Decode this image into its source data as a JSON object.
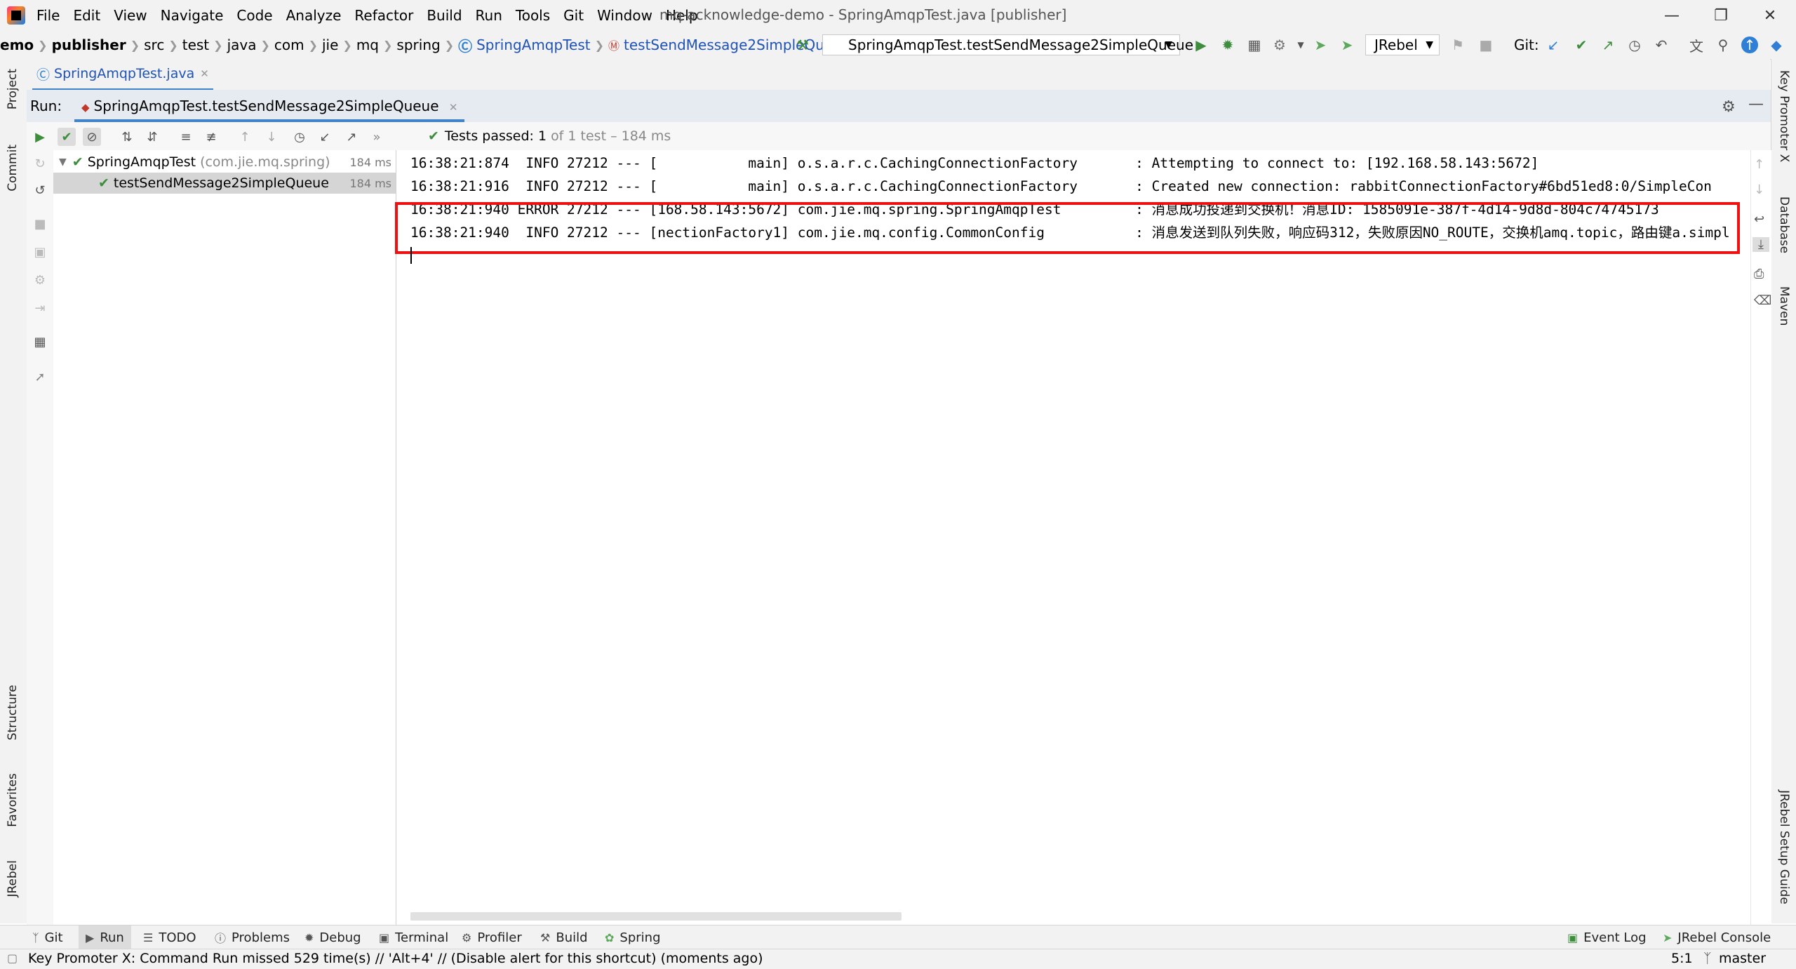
{
  "window": {
    "title": "mq-acknowledge-demo - SpringAmqpTest.java [publisher]",
    "menu": [
      "File",
      "Edit",
      "View",
      "Navigate",
      "Code",
      "Analyze",
      "Refactor",
      "Build",
      "Run",
      "Tools",
      "Git",
      "Window",
      "Help"
    ]
  },
  "breadcrumb": [
    "emo",
    "publisher",
    "src",
    "test",
    "java",
    "com",
    "jie",
    "mq",
    "spring",
    "SpringAmqpTest",
    "testSendMessage2SimpleQueue"
  ],
  "toolbar": {
    "run_config": "SpringAmqpTest.testSendMessage2SimpleQueue",
    "jrebel": "JRebel",
    "git_label": "Git:"
  },
  "editor_tab": "SpringAmqpTest.java",
  "left_strip": [
    "Project",
    "Commit",
    "Structure",
    "Favorites",
    "JRebel"
  ],
  "right_strip": [
    "Key Promoter X",
    "Database",
    "Maven",
    "JRebel Setup Guide"
  ],
  "run_panel": {
    "label": "Run:",
    "tab": "SpringAmqpTest.testSendMessage2SimpleQueue",
    "status_passed": "Tests passed: 1",
    "status_rest": "of 1 test – 184 ms"
  },
  "test_tree": {
    "root_name": "SpringAmqpTest",
    "root_pkg": "(com.jie.mq.spring)",
    "root_time": "184 ms",
    "child_name": "testSendMessage2SimpleQueue",
    "child_time": "184 ms"
  },
  "console": [
    "16:38:21:874  INFO 27212 --- [           main] o.s.a.r.c.CachingConnectionFactory       : Attempting to connect to: [192.168.58.143:5672]",
    "16:38:21:916  INFO 27212 --- [           main] o.s.a.r.c.CachingConnectionFactory       : Created new connection: rabbitConnectionFactory#6bd51ed8:0/SimpleCon",
    "16:38:21:940 ERROR 27212 --- [168.58.143:5672] com.jie.mq.spring.SpringAmqpTest         : 消息成功投递到交换机！消息ID: 1585091e-387f-4d14-9d8d-804c74745173",
    "16:38:21:940  INFO 27212 --- [nectionFactory1] com.jie.mq.config.CommonConfig           : 消息发送到队列失败，响应码312，失败原因NO_ROUTE，交换机amq.topic，路由键a.simpl"
  ],
  "bottom_tools": [
    "Git",
    "Run",
    "TODO",
    "Problems",
    "Debug",
    "Terminal",
    "Profiler",
    "Build",
    "Spring",
    "Event Log",
    "JRebel Console"
  ],
  "status": {
    "message": "Key Promoter X: Command Run missed 529 time(s) // 'Alt+4' // (Disable alert for this shortcut) (moments ago)",
    "position": "5:1",
    "branch": "master"
  },
  "colors": {
    "highlight": "#ee1111",
    "pass_green": "#499c54",
    "link_blue": "#1f52b8",
    "accent": "#4083c9"
  }
}
